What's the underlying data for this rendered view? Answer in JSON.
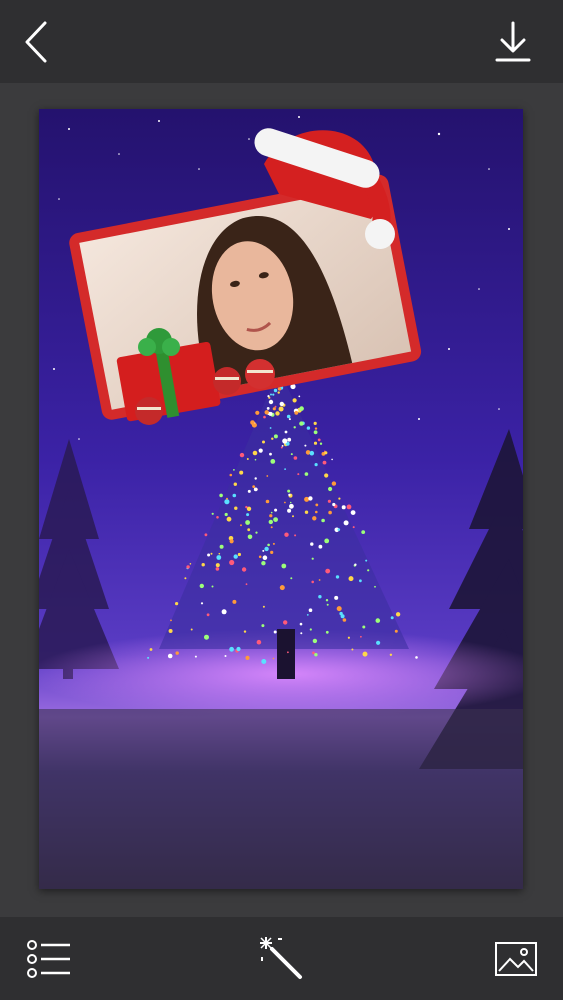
{
  "toolbar": {
    "back_icon": "chevron-left-icon",
    "download_icon": "download-icon"
  },
  "editor": {
    "frame_theme": "christmas",
    "stickers": [
      "santa-hat",
      "gift-box",
      "ornament",
      "ornament",
      "ornament"
    ]
  },
  "bottom_toolbar": {
    "menu_icon": "list-icon",
    "effects_icon": "magic-wand-icon",
    "gallery_icon": "image-icon"
  },
  "colors": {
    "bar_background": "#2f2f31",
    "canvas_background": "#3b3b3d",
    "frame_red": "#d42a2a",
    "sky_purple": "#3a1f9a"
  }
}
